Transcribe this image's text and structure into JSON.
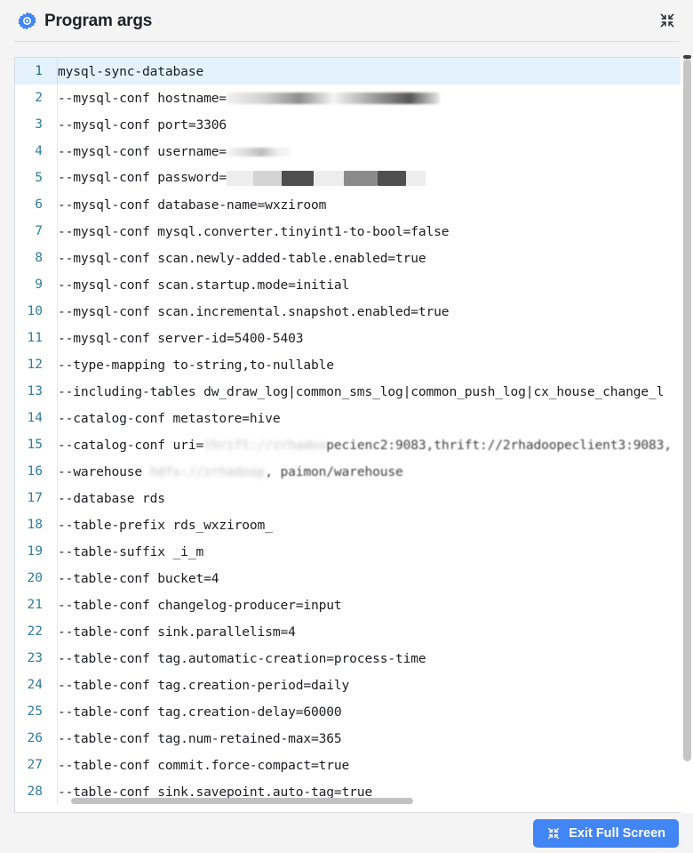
{
  "header": {
    "title": "Program args",
    "icon": "gear-icon",
    "collapse_icon": "collapse-arrows-icon"
  },
  "editor": {
    "active_line": 1,
    "accent_line_number_color": "#2f7d9b",
    "active_line_background": "#e3f2fd",
    "lines": [
      {
        "n": "1",
        "text": "mysql-sync-database"
      },
      {
        "n": "2",
        "text": "--mysql-conf hostname=",
        "redacted": true
      },
      {
        "n": "3",
        "text": "--mysql-conf port=3306"
      },
      {
        "n": "4",
        "text": "--mysql-conf username=",
        "redacted": true
      },
      {
        "n": "5",
        "text": "--mysql-conf password=",
        "redacted": true
      },
      {
        "n": "6",
        "text": "--mysql-conf database-name=wxziroom"
      },
      {
        "n": "7",
        "text": "--mysql-conf mysql.converter.tinyint1-to-bool=false"
      },
      {
        "n": "8",
        "text": "--mysql-conf scan.newly-added-table.enabled=true"
      },
      {
        "n": "9",
        "text": "--mysql-conf scan.startup.mode=initial"
      },
      {
        "n": "10",
        "text": "--mysql-conf scan.incremental.snapshot.enabled=true"
      },
      {
        "n": "11",
        "text": "--mysql-conf server-id=5400-5403"
      },
      {
        "n": "12",
        "text": "--type-mapping to-string,to-nullable"
      },
      {
        "n": "13",
        "text": "--including-tables dw_draw_log|common_sms_log|common_push_log|cx_house_change_l"
      },
      {
        "n": "14",
        "text": "--catalog-conf metastore=hive"
      },
      {
        "n": "15",
        "text": "--catalog-conf uri=",
        "redacted": true
      },
      {
        "n": "16",
        "text": "--warehouse ",
        "redacted": true
      },
      {
        "n": "17",
        "text": "--database rds"
      },
      {
        "n": "18",
        "text": "--table-prefix rds_wxziroom_"
      },
      {
        "n": "19",
        "text": "--table-suffix _i_m"
      },
      {
        "n": "20",
        "text": "--table-conf bucket=4"
      },
      {
        "n": "21",
        "text": "--table-conf changelog-producer=input"
      },
      {
        "n": "22",
        "text": "--table-conf sink.parallelism=4"
      },
      {
        "n": "23",
        "text": "--table-conf tag.automatic-creation=process-time"
      },
      {
        "n": "24",
        "text": "--table-conf tag.creation-period=daily"
      },
      {
        "n": "25",
        "text": "--table-conf tag.creation-delay=60000"
      },
      {
        "n": "26",
        "text": "--table-conf tag.num-retained-max=365"
      },
      {
        "n": "27",
        "text": "--table-conf commit.force-compact=true"
      },
      {
        "n": "28",
        "text": "--table-conf sink.savepoint.auto-tag=true"
      }
    ],
    "redacted_fragments": {
      "line15_tail": "pecienc2:9083,thrift://2rhadoopeclient3:9083,",
      "line16_tail": ", paimon/warehouse"
    }
  },
  "footer": {
    "exit_fullscreen_label": "Exit Full Screen",
    "exit_fullscreen_icon": "collapse-arrows-icon",
    "button_color": "#4285f4"
  }
}
